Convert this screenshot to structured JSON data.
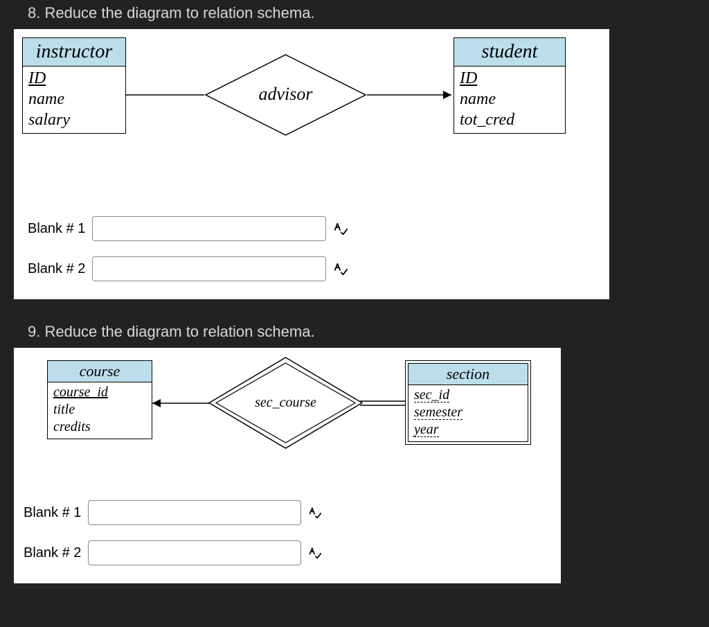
{
  "q8": {
    "prompt": "8. Reduce the diagram to relation schema.",
    "entities": {
      "left": {
        "title": "instructor",
        "attrs": [
          "ID",
          "name",
          "salary"
        ],
        "pk_index": 0
      },
      "right": {
        "title": "student",
        "attrs": [
          "ID",
          "name",
          "tot_cred"
        ],
        "pk_index": 0
      }
    },
    "relationship": "advisor",
    "blanks": {
      "b1_label": "Blank # 1",
      "b2_label": "Blank # 2"
    }
  },
  "q9": {
    "prompt": "9. Reduce the diagram to relation schema.",
    "entities": {
      "left": {
        "title": "course",
        "attrs": [
          "course_id",
          "title",
          "credits"
        ],
        "pk_index": 0
      },
      "right": {
        "title": "section",
        "attrs": [
          "sec_id",
          "semester",
          "year"
        ],
        "dashed_all": true
      }
    },
    "relationship": "sec_course",
    "blanks": {
      "b1_label": "Blank # 1",
      "b2_label": "Blank # 2"
    }
  }
}
